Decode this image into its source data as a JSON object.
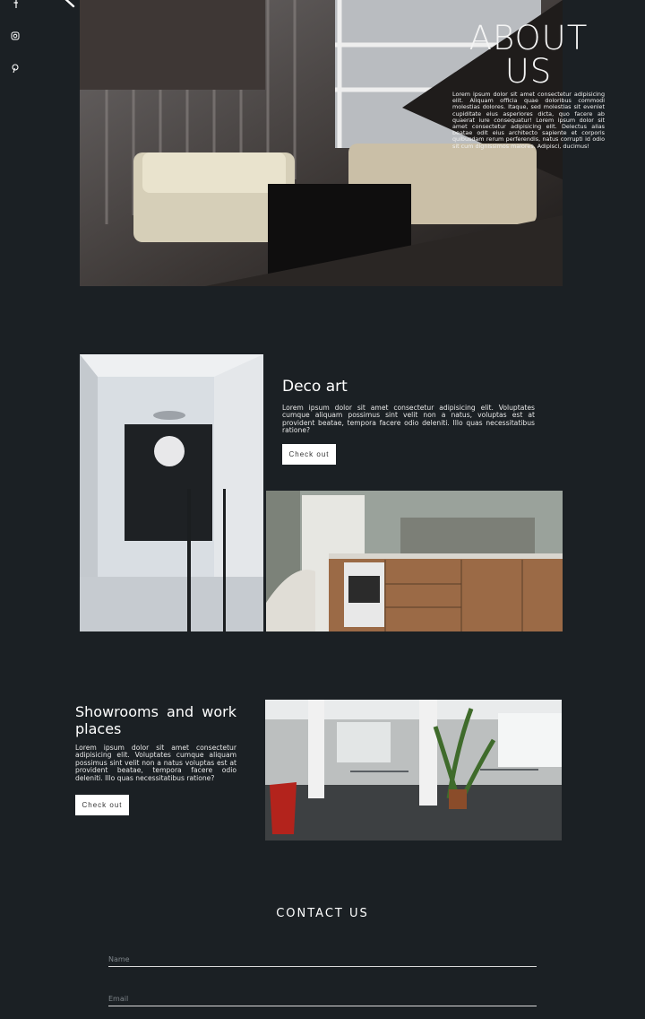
{
  "social": {
    "icons": [
      "facebook-icon",
      "instagram-icon",
      "pinterest-icon"
    ]
  },
  "about": {
    "title_line1": "ABOUT",
    "title_line2": "US",
    "text": "Lorem ipsum dolor sit amet consectetur adipisicing elit. Aliquam officia quae doloribus commodi molestias dolores. Itaque, sed molestias sit eveniet cupiditate eius asperiores dicta, quo facere ab quaerat iure consequatur! Lorem ipsum dolor sit amet consectetur adipisicing elit. Delectus alias beatae odit eius architecto sapiente et corporis quibusdam rerum perferendis, natus corrupti id odio sit cum dignissimos maiores. Adipisci, ducimus!"
  },
  "deco": {
    "title": "Deco art",
    "text": "Lorem ipsum dolor sit amet consectetur adipisicing elit. Voluptates cumque aliquam possimus sint velit non a natus, voluptas est at provident beatae, tempora facere odio deleniti. Illo quas necessitatibus ratione?",
    "button": "Check out"
  },
  "showrooms": {
    "title": "Showrooms and work places",
    "text": "Lorem ipsum dolor sit amet consectetur adipisicing elit. Voluptates cumque aliquam possimus sint velit non a natus voluptas est at provident beatae, tempora facere odio deleniti. Illo quas necessitatibus ratione?",
    "button": "Check out"
  },
  "contact": {
    "title": "CONTACT US",
    "name_placeholder": "Name",
    "email_placeholder": "Email"
  },
  "colors": {
    "background": "#1b2024",
    "text": "#ffffff",
    "button_bg": "#ffffff"
  }
}
